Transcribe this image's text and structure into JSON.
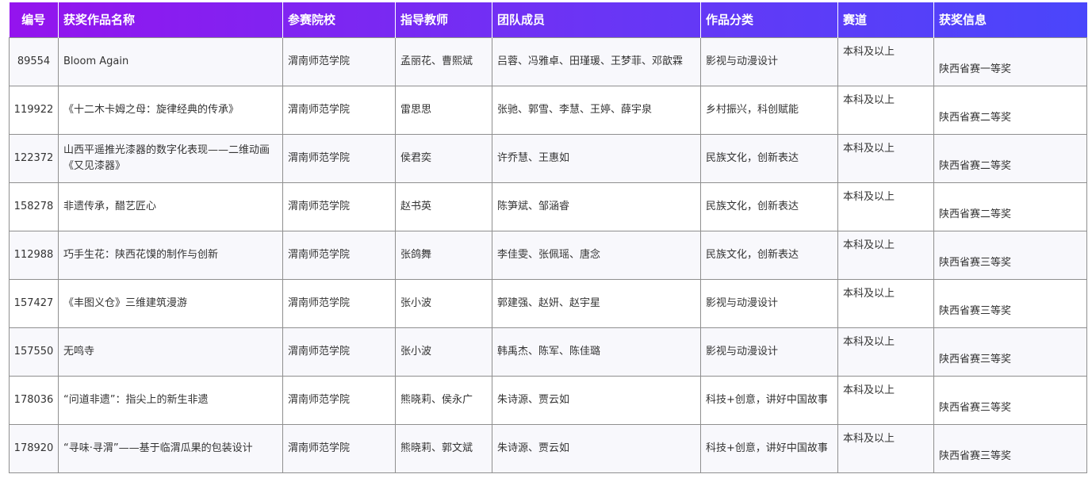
{
  "table": {
    "headers": {
      "id": "编号",
      "work": "获奖作品名称",
      "school": "参赛院校",
      "teacher": "指导教师",
      "members": "团队成员",
      "category": "作品分类",
      "track": "赛道",
      "award": "获奖信息"
    },
    "rows": [
      {
        "id": "89554",
        "work": "Bloom Again",
        "school": "渭南师范学院",
        "teacher": "孟丽花、曹熙斌",
        "members": "吕蓉、冯雅卓、田瑾瑗、王梦菲、邓歆霖",
        "category": "影视与动漫设计",
        "track": "本科及以上",
        "award": "陕西省赛一等奖"
      },
      {
        "id": "119922",
        "work": "《十二木卡姆之母：旋律经典的传承》",
        "school": "渭南师范学院",
        "teacher": "雷思思",
        "members": "张驰、郭雪、李慧、王婷、薛宇泉",
        "category": "乡村振兴，科创赋能",
        "track": "本科及以上",
        "award": "陕西省赛二等奖"
      },
      {
        "id": "122372",
        "work": "山西平遥推光漆器的数字化表现——二维动画《又见漆器》",
        "school": "渭南师范学院",
        "teacher": "侯君奕",
        "members": "许乔慧、王惠如",
        "category": "民族文化，创新表达",
        "track": "本科及以上",
        "award": "陕西省赛二等奖"
      },
      {
        "id": "158278",
        "work": "非遗传承，醋艺匠心",
        "school": "渭南师范学院",
        "teacher": "赵书英",
        "members": "陈笋斌、邹涵睿",
        "category": "民族文化，创新表达",
        "track": "本科及以上",
        "award": "陕西省赛二等奖"
      },
      {
        "id": "112988",
        "work": "巧手生花：陕西花馍的制作与创新",
        "school": "渭南师范学院",
        "teacher": "张鸽舞",
        "members": "李佳雯、张佩瑶、唐念",
        "category": "民族文化，创新表达",
        "track": "本科及以上",
        "award": "陕西省赛三等奖"
      },
      {
        "id": "157427",
        "work": "《丰图义仓》三维建筑漫游",
        "school": "渭南师范学院",
        "teacher": "张小波",
        "members": "郭建强、赵妍、赵宇星",
        "category": "影视与动漫设计",
        "track": "本科及以上",
        "award": "陕西省赛三等奖"
      },
      {
        "id": "157550",
        "work": "无鸣寺",
        "school": "渭南师范学院",
        "teacher": "张小波",
        "members": "韩禹杰、陈军、陈佳璐",
        "category": "影视与动漫设计",
        "track": "本科及以上",
        "award": "陕西省赛三等奖"
      },
      {
        "id": "178036",
        "work": "“问道非遗”：指尖上的新生非遗",
        "school": "渭南师范学院",
        "teacher": "熊晓莉、侯永广",
        "members": "朱诗源、贾云如",
        "category": "科技+创意，讲好中国故事",
        "track": "本科及以上",
        "award": "陕西省赛三等奖"
      },
      {
        "id": "178920",
        "work": "“寻味·寻渭”——基于临渭瓜果的包装设计",
        "school": "渭南师范学院",
        "teacher": "熊晓莉、郭文斌",
        "members": "朱诗源、贾云如",
        "category": "科技+创意，讲好中国故事",
        "track": "本科及以上",
        "award": "陕西省赛三等奖"
      }
    ]
  },
  "colors": {
    "header_gradient_start": "#9414ee",
    "header_gradient_end": "#4a46fb",
    "header_text": "#ffffff",
    "border": "#8f8f8f",
    "row_stripe": "#f8f8fc"
  }
}
